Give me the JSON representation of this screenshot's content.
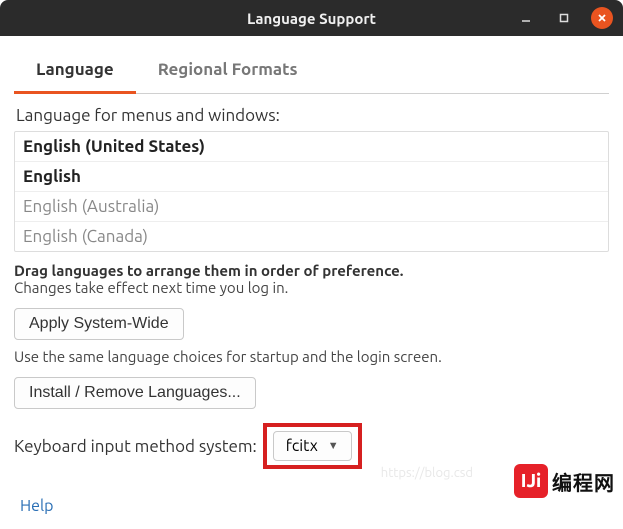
{
  "window": {
    "title": "Language Support"
  },
  "tabs": {
    "language": "Language",
    "regional": "Regional Formats"
  },
  "main": {
    "list_label": "Language for menus and windows:",
    "languages": [
      {
        "name": "English (United States)",
        "primary": true
      },
      {
        "name": "English",
        "primary": true
      },
      {
        "name": "English (Australia)",
        "primary": false
      },
      {
        "name": "English (Canada)",
        "primary": false
      }
    ],
    "drag_hint_bold": "Drag languages to arrange them in order of preference.",
    "drag_hint": "Changes take effect next time you log in.",
    "apply_btn": "Apply System-Wide",
    "apply_desc": "Use the same language choices for startup and the login screen.",
    "install_btn": "Install / Remove Languages...",
    "kb_label": "Keyboard input method system:",
    "kb_value": "fcitx"
  },
  "footer": {
    "help": "Help"
  },
  "watermark": {
    "badge": "IJi",
    "text": "编程网",
    "url": "https://blog.csd"
  }
}
